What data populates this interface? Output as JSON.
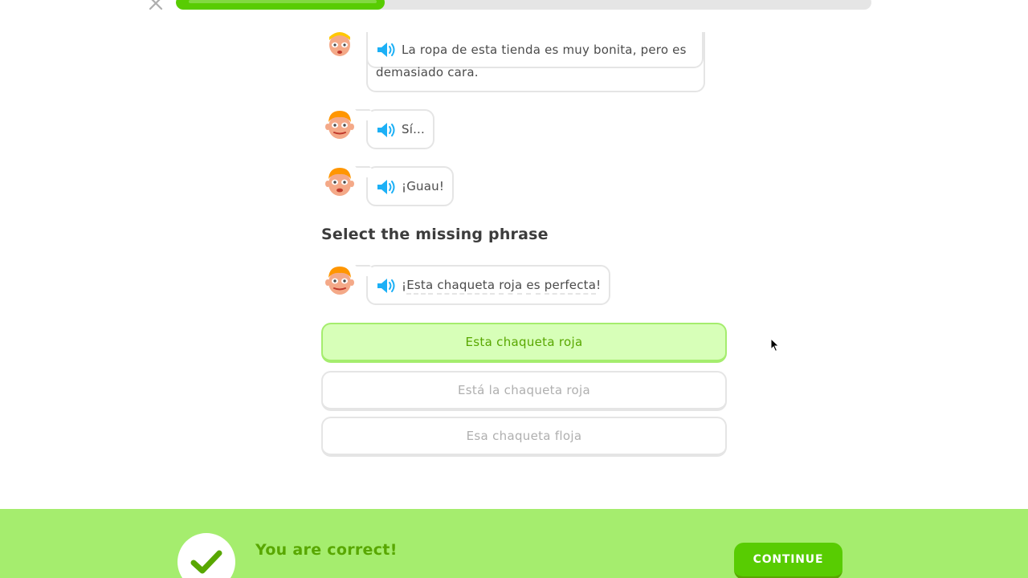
{
  "header": {
    "close_icon": "close-icon",
    "progress_fraction": 0.3
  },
  "chat": [
    {
      "speaker": "blonde-character",
      "text": "La ropa de esta tienda es muy bonita, pero es demasiado cara."
    },
    {
      "speaker": "redhead-character",
      "text": "Sí..."
    },
    {
      "speaker": "redhead-character",
      "text": "¡Guau!"
    }
  ],
  "prompt": {
    "heading": "Select the missing phrase",
    "sentence_open": "¡",
    "sentence_words": [
      "Esta",
      "chaqueta",
      "roja",
      "es",
      "perfecta"
    ],
    "sentence_close": "!"
  },
  "options": [
    {
      "label": "Esta chaqueta roja",
      "selected": true
    },
    {
      "label": "Está la chaqueta roja",
      "selected": false
    },
    {
      "label": "Esa chaqueta floja",
      "selected": false
    }
  ],
  "footer": {
    "status": "You are correct!",
    "continue_label": "CONTINUE",
    "icon": "check-icon"
  },
  "colors": {
    "green": "#58cc02",
    "dark_green": "#58a700",
    "light_green": "#d7ffb8",
    "footer_green": "#a5ed6e",
    "speaker_blue": "#1cb0f6"
  }
}
